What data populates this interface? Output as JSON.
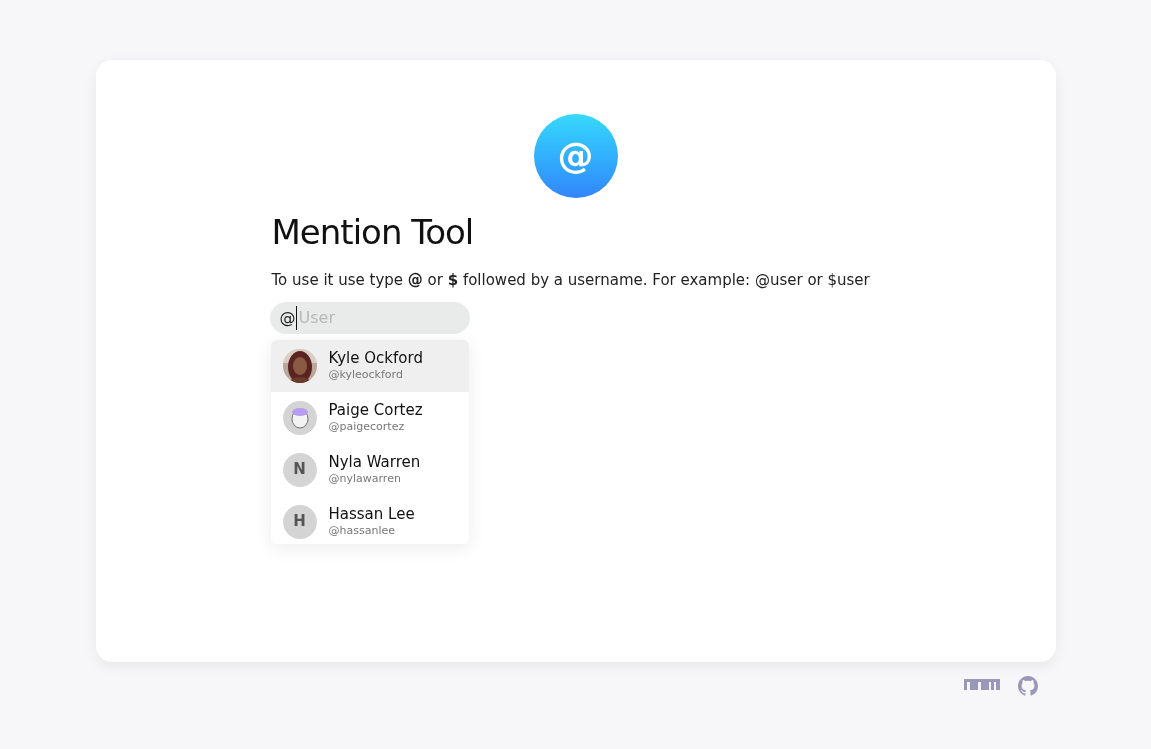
{
  "logo": {
    "symbol": "@"
  },
  "title": "Mention Tool",
  "description": "To use it use type **@** or **$** followed by a username. For example: @user or $user",
  "input": {
    "prefix": "@",
    "placeholder": "User"
  },
  "suggestions": [
    {
      "name": "Kyle Ockford",
      "handle": "@kyleockford",
      "selected": true
    },
    {
      "name": "Paige Cortez",
      "handle": "@paigecortez",
      "kind": "illustration",
      "selected": false
    },
    {
      "name": "Nyla Warren",
      "handle": "@nylawarren",
      "kind": "initial",
      "initial": "N",
      "selected": false
    },
    {
      "name": "Hassan Lee",
      "handle": "@hassanlee",
      "kind": "initial",
      "initial": "H",
      "selected": false
    }
  ]
}
